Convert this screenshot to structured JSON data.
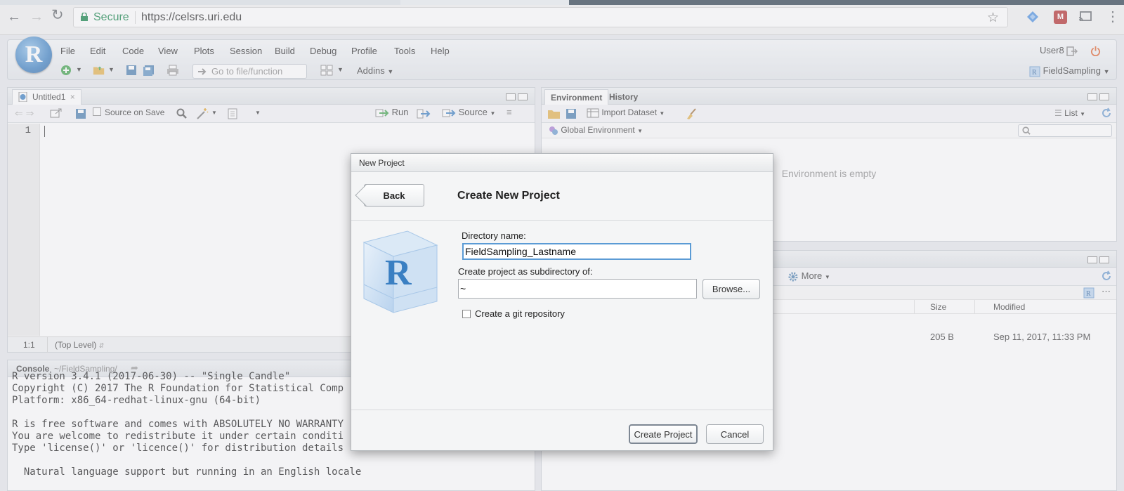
{
  "browser": {
    "secure_label": "Secure",
    "url": "https://celsrs.uri.edu"
  },
  "rstudio": {
    "menu": [
      "File",
      "Edit",
      "Code",
      "View",
      "Plots",
      "Session",
      "Build",
      "Debug",
      "Profile",
      "Tools",
      "Help"
    ],
    "user": "User8",
    "goto_placeholder": "Go to file/function",
    "addins": "Addins",
    "project": "FieldSampling",
    "editor": {
      "tab": "Untitled1",
      "source_on_save": "Source on Save",
      "run": "Run",
      "source": "Source",
      "line_number": "1",
      "cursor_pos": "1:1",
      "scope": "(Top Level)"
    },
    "env": {
      "tabs": [
        "Environment",
        "History"
      ],
      "import_dataset": "Import Dataset",
      "list_label": "List",
      "global_env": "Global Environment",
      "empty_msg": "Environment is empty"
    },
    "files": {
      "more": "More",
      "col_size": "Size",
      "col_modified": "Modified",
      "row_size": "205 B",
      "row_modified": "Sep 11, 2017, 11:33 PM"
    },
    "console": {
      "title": "Console",
      "path": "~/FieldSampling/",
      "lines": [
        "R version 3.4.1 (2017-06-30) -- \"Single Candle\"",
        "Copyright (C) 2017 The R Foundation for Statistical Comp",
        "Platform: x86_64-redhat-linux-gnu (64-bit)",
        "",
        "R is free software and comes with ABSOLUTELY NO WARRANTY",
        "You are welcome to redistribute it under certain conditi",
        "Type 'license()' or 'licence()' for distribution details",
        "",
        "  Natural language support but running in an English locale"
      ]
    }
  },
  "dialog": {
    "title": "New Project",
    "back": "Back",
    "heading": "Create New Project",
    "dir_label": "Directory name:",
    "dir_value": "FieldSampling_Lastname",
    "subdir_label": "Create project as subdirectory of:",
    "subdir_value": "~",
    "browse": "Browse...",
    "git_label": "Create a git repository",
    "git_checked": false,
    "create": "Create Project",
    "cancel": "Cancel"
  },
  "colors": {
    "accent_blue": "#3a7fc2",
    "secure_green": "#0b8043",
    "focus_border": "#5b9bd5"
  }
}
